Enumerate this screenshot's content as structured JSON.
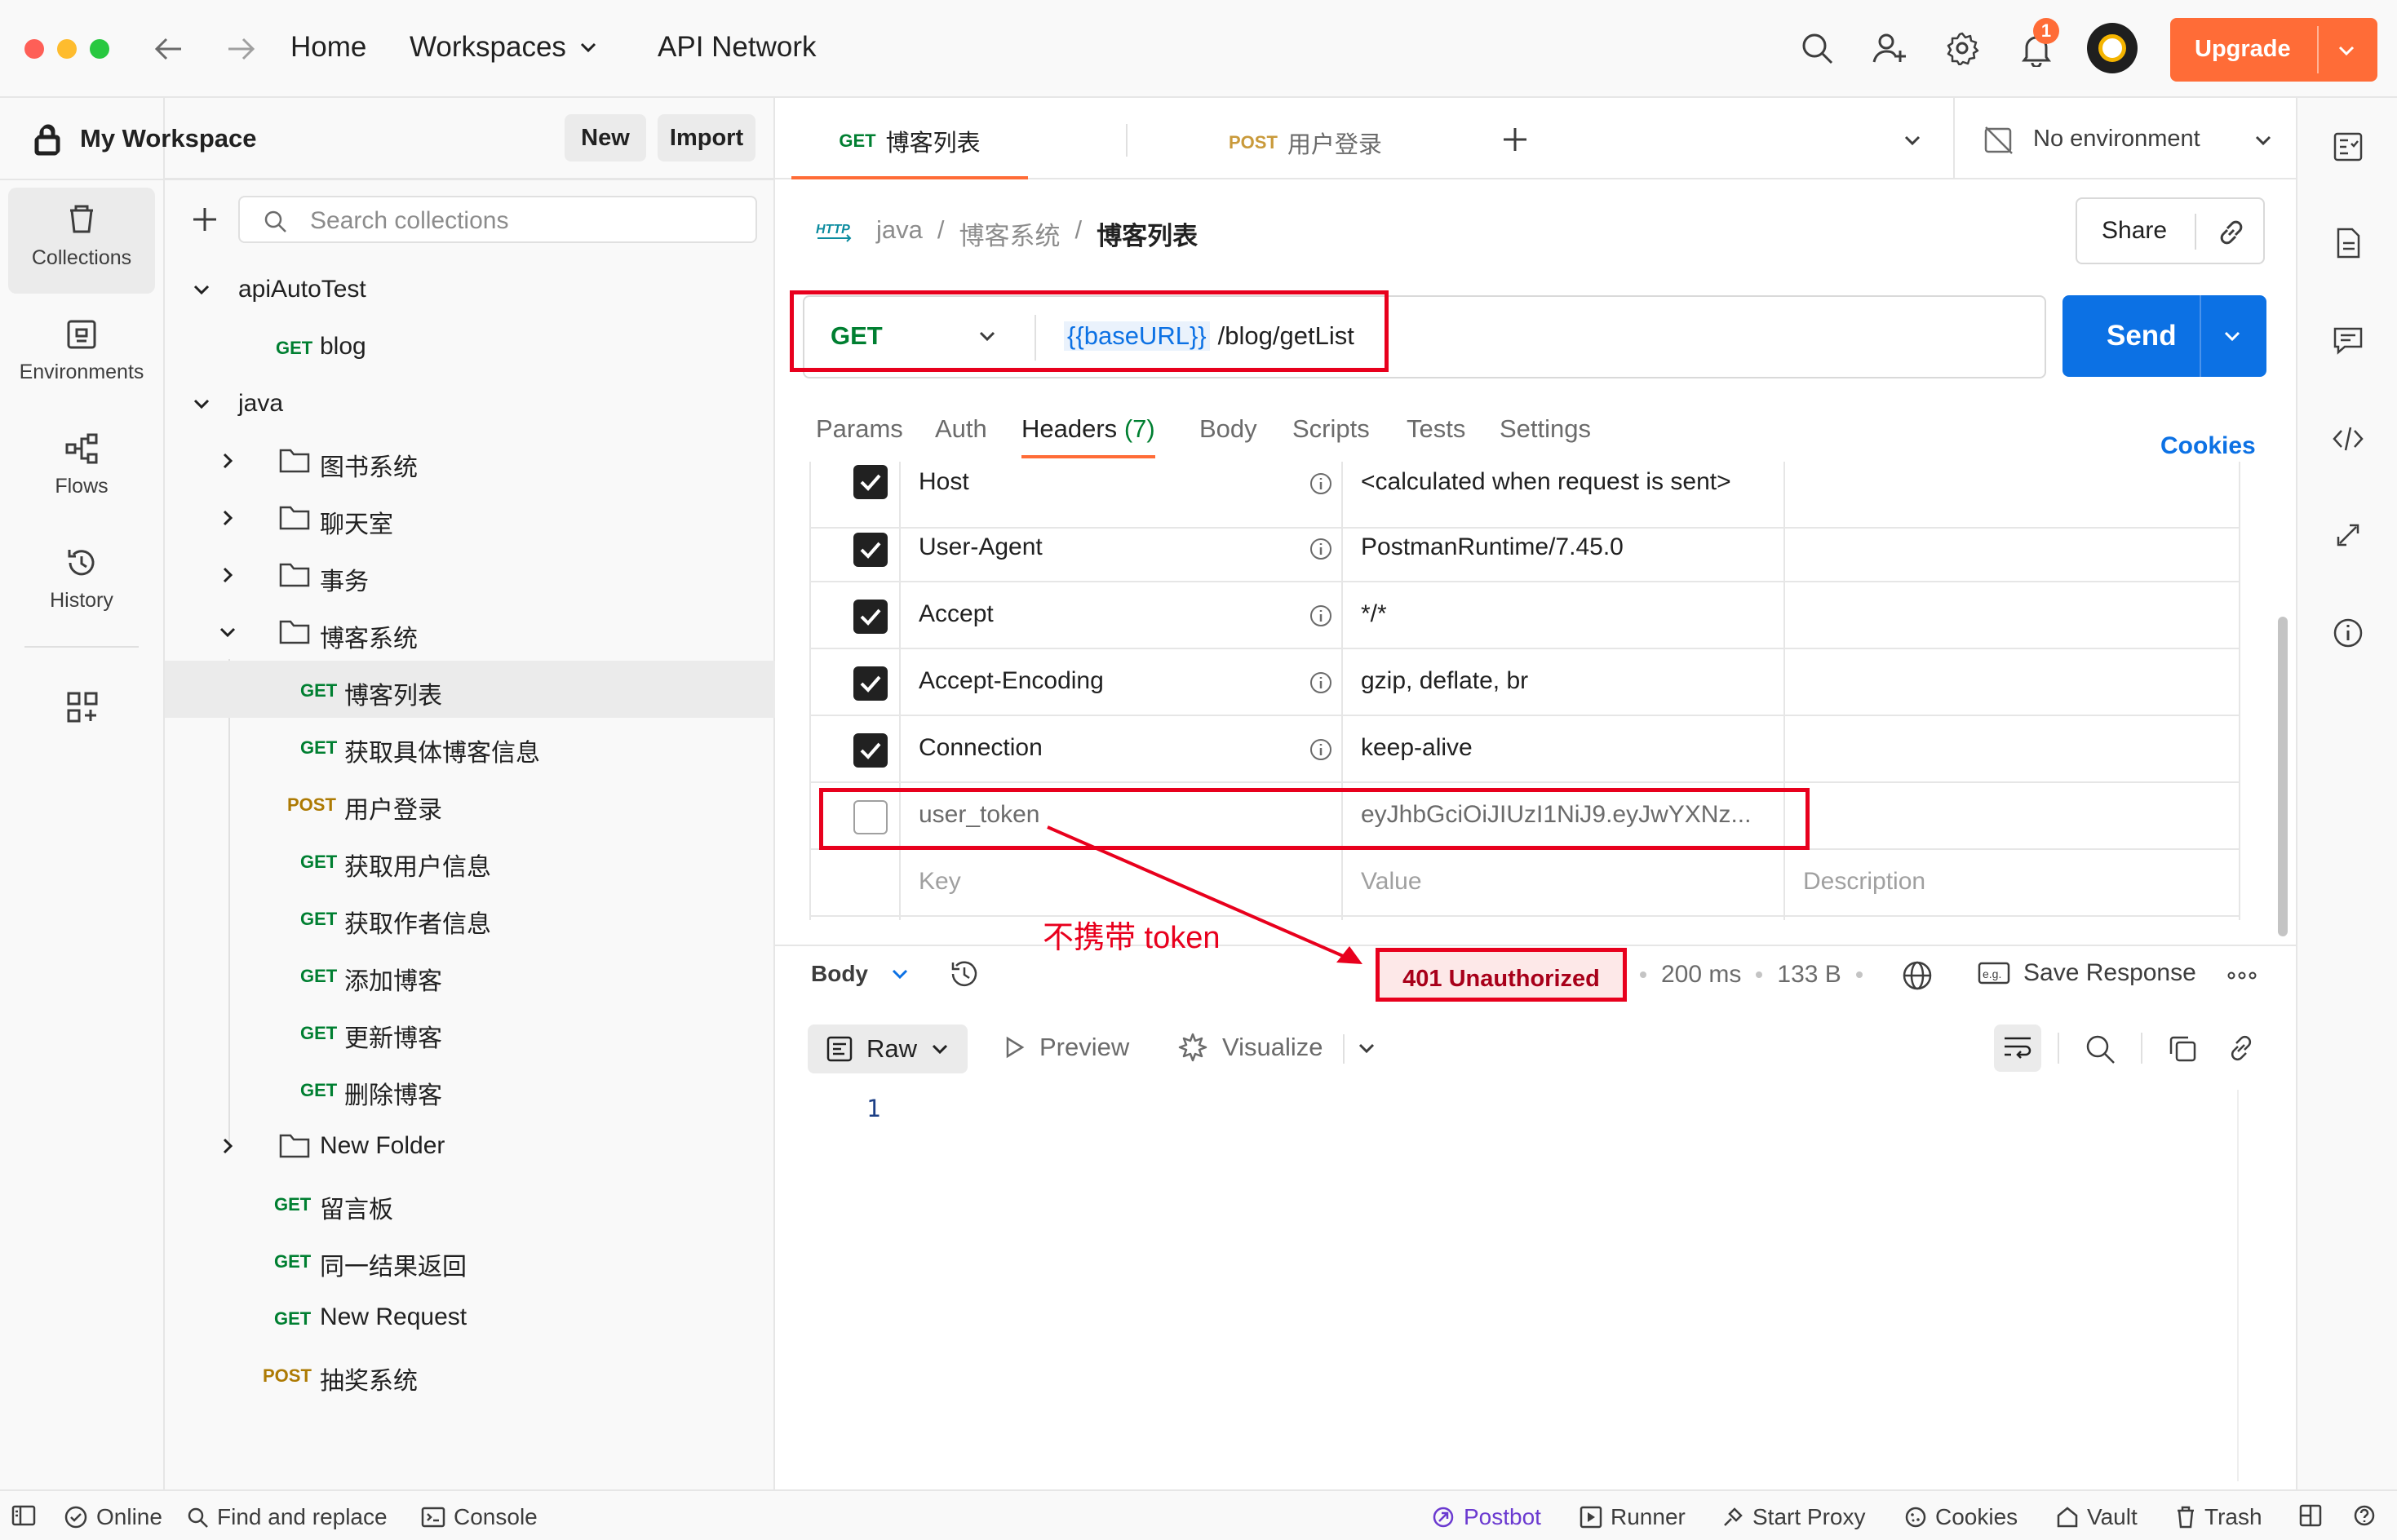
{
  "topbar": {
    "home": "Home",
    "workspaces": "Workspaces",
    "api_network": "API Network",
    "notification_count": "1",
    "upgrade": "Upgrade"
  },
  "workspace": {
    "name": "My Workspace",
    "new_label": "New",
    "import_label": "Import",
    "search_placeholder": "Search collections"
  },
  "rail": {
    "collections": "Collections",
    "environments": "Environments",
    "flows": "Flows",
    "history": "History"
  },
  "tree": [
    {
      "label": "apiAutoTest"
    },
    {
      "method": "GET",
      "label": "blog"
    },
    {
      "label": "java"
    },
    {
      "label": "图书系统"
    },
    {
      "label": "聊天室"
    },
    {
      "label": "事务"
    },
    {
      "label": "博客系统"
    },
    {
      "method": "GET",
      "label": "博客列表"
    },
    {
      "method": "GET",
      "label": "获取具体博客信息"
    },
    {
      "method": "POST",
      "label": "用户登录"
    },
    {
      "method": "GET",
      "label": "获取用户信息"
    },
    {
      "method": "GET",
      "label": "获取作者信息"
    },
    {
      "method": "GET",
      "label": "添加博客"
    },
    {
      "method": "GET",
      "label": "更新博客"
    },
    {
      "method": "GET",
      "label": "删除博客"
    },
    {
      "label": "New Folder"
    },
    {
      "method": "GET",
      "label": "留言板"
    },
    {
      "method": "GET",
      "label": "同一结果返回"
    },
    {
      "method": "GET",
      "label": "New Request"
    },
    {
      "method": "POST",
      "label": "抽奖系统"
    }
  ],
  "tabs": [
    {
      "method": "GET",
      "label": "博客列表"
    },
    {
      "method": "POST",
      "label": "用户登录"
    }
  ],
  "environment": "No environment",
  "breadcrumb": {
    "http": "HTTP",
    "c1": "java",
    "sep": "/",
    "c2": "博客系统",
    "c3": "博客列表"
  },
  "share": "Share",
  "request": {
    "method": "GET",
    "url_var": "{{baseURL}}",
    "url_path": "/blog/getList",
    "send": "Send"
  },
  "req_tabs": {
    "params": "Params",
    "auth": "Auth",
    "headers": "Headers",
    "headers_count": "(7)",
    "body": "Body",
    "scripts": "Scripts",
    "tests": "Tests",
    "settings": "Settings",
    "cookies": "Cookies"
  },
  "headers": [
    {
      "key": "Host",
      "value": "<calculated when request is sent>",
      "checked": true
    },
    {
      "key": "User-Agent",
      "value": "PostmanRuntime/7.45.0",
      "checked": true
    },
    {
      "key": "Accept",
      "value": "*/*",
      "checked": true
    },
    {
      "key": "Accept-Encoding",
      "value": "gzip, deflate, br",
      "checked": true
    },
    {
      "key": "Connection",
      "value": "keep-alive",
      "checked": true
    },
    {
      "key": "user_token",
      "value": "eyJhbGciOiJIUzI1NiJ9.eyJwYXNz...",
      "checked": false
    }
  ],
  "placeholders": {
    "key": "Key",
    "value": "Value",
    "description": "Description"
  },
  "annotation": "不携带 token",
  "response": {
    "body": "Body",
    "status": "401 Unauthorized",
    "time": "200 ms",
    "size": "133 B",
    "save": "Save Response",
    "raw": "Raw",
    "preview": "Preview",
    "visualize": "Visualize",
    "line_no": "1"
  },
  "statusbar": {
    "online": "Online",
    "find": "Find and replace",
    "console": "Console",
    "postbot": "Postbot",
    "runner": "Runner",
    "proxy": "Start Proxy",
    "cookies": "Cookies",
    "vault": "Vault",
    "trash": "Trash"
  },
  "colors": {
    "accent": "#ff6c37",
    "send": "#0c71e4",
    "annotation": "#e8001d",
    "get": "#007f31",
    "post": "#ad7a03"
  }
}
